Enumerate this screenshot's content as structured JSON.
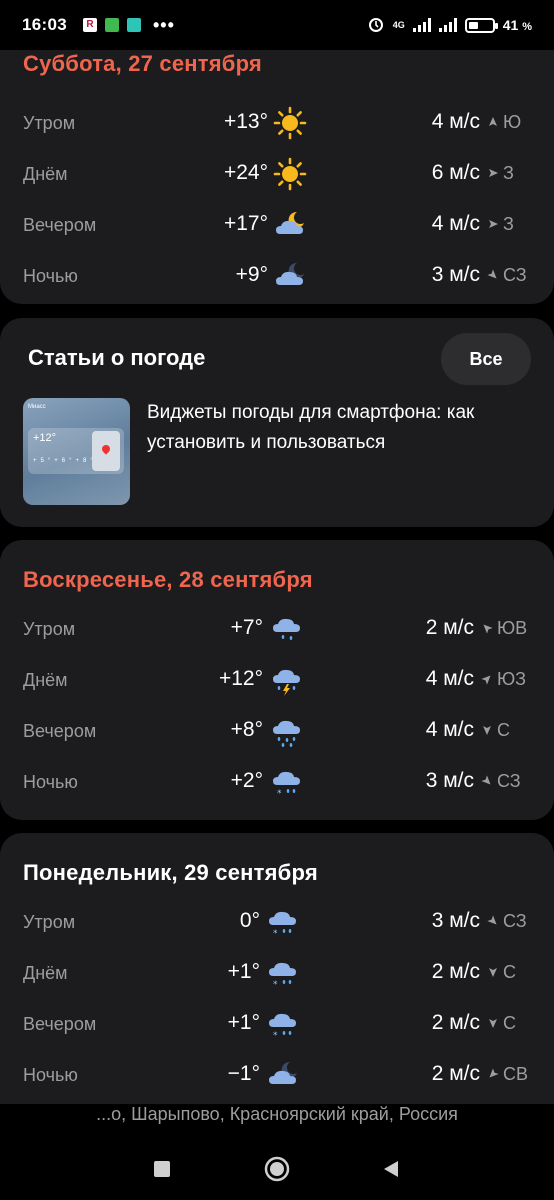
{
  "status_bar": {
    "time": "16:03",
    "network": "4G",
    "battery_percent": "41",
    "battery_unit": "%",
    "battery_level": 0.41
  },
  "days": [
    {
      "title": "Суббота, 27 сентября",
      "title_color": "#f0654d",
      "rows": [
        {
          "part": "Утром",
          "temp": "+13°",
          "icon": "sun-icon",
          "wind": "4 м/с",
          "dir": "Ю",
          "arrow_angle": 0
        },
        {
          "part": "Днём",
          "temp": "+24°",
          "icon": "sun-icon",
          "wind": "6 м/с",
          "dir": "З",
          "arrow_angle": 90
        },
        {
          "part": "Вечером",
          "temp": "+17°",
          "icon": "cloudy-night-icon",
          "wind": "4 м/с",
          "dir": "З",
          "arrow_angle": 90
        },
        {
          "part": "Ночью",
          "temp": "+9°",
          "icon": "cloudy-night-icon",
          "wind": "3 м/с",
          "dir": "СЗ",
          "arrow_angle": 135
        }
      ]
    },
    {
      "title": "Воскресенье, 28 сентября",
      "title_color": "#f0654d",
      "rows": [
        {
          "part": "Утром",
          "temp": "+7°",
          "icon": "light-rain-icon",
          "wind": "2 м/с",
          "dir": "ЮВ",
          "arrow_angle": 315
        },
        {
          "part": "Днём",
          "temp": "+12°",
          "icon": "thunderstorm-icon",
          "wind": "4 м/с",
          "dir": "ЮЗ",
          "arrow_angle": 45
        },
        {
          "part": "Вечером",
          "temp": "+8°",
          "icon": "rain-icon",
          "wind": "4 м/с",
          "dir": "С",
          "arrow_angle": 180
        },
        {
          "part": "Ночью",
          "temp": "+2°",
          "icon": "rain-snow-icon",
          "wind": "3 м/с",
          "dir": "СЗ",
          "arrow_angle": 135
        }
      ]
    },
    {
      "title": "Понедельник, 29 сентября",
      "title_color": "#ffffff",
      "rows": [
        {
          "part": "Утром",
          "temp": "0°",
          "icon": "rain-snow-icon",
          "wind": "3 м/с",
          "dir": "СЗ",
          "arrow_angle": 135
        },
        {
          "part": "Днём",
          "temp": "+1°",
          "icon": "rain-snow-icon",
          "wind": "2 м/с",
          "dir": "С",
          "arrow_angle": 180
        },
        {
          "part": "Вечером",
          "temp": "+1°",
          "icon": "rain-snow-icon",
          "wind": "2 м/с",
          "dir": "С",
          "arrow_angle": 180
        },
        {
          "part": "Ночью",
          "temp": "−1°",
          "icon": "cloudy-night-icon",
          "wind": "2 м/с",
          "dir": "СВ",
          "arrow_angle": 225
        }
      ]
    }
  ],
  "articles": {
    "title": "Статьи о погоде",
    "all_button": "Все",
    "items": [
      {
        "text": "Виджеты погоды для смартфона: как установить и пользоваться",
        "thumb_temp": "+12°"
      }
    ]
  },
  "location": "...о, Шарыпово, Красноярский край, Россия",
  "colors": {
    "background": "#000000",
    "card": "#1c1c1e",
    "accent_red": "#f0654d",
    "secondary_text": "#9d9d9f",
    "sun": "#f7b91c",
    "cloud": "#8fb3e8"
  }
}
